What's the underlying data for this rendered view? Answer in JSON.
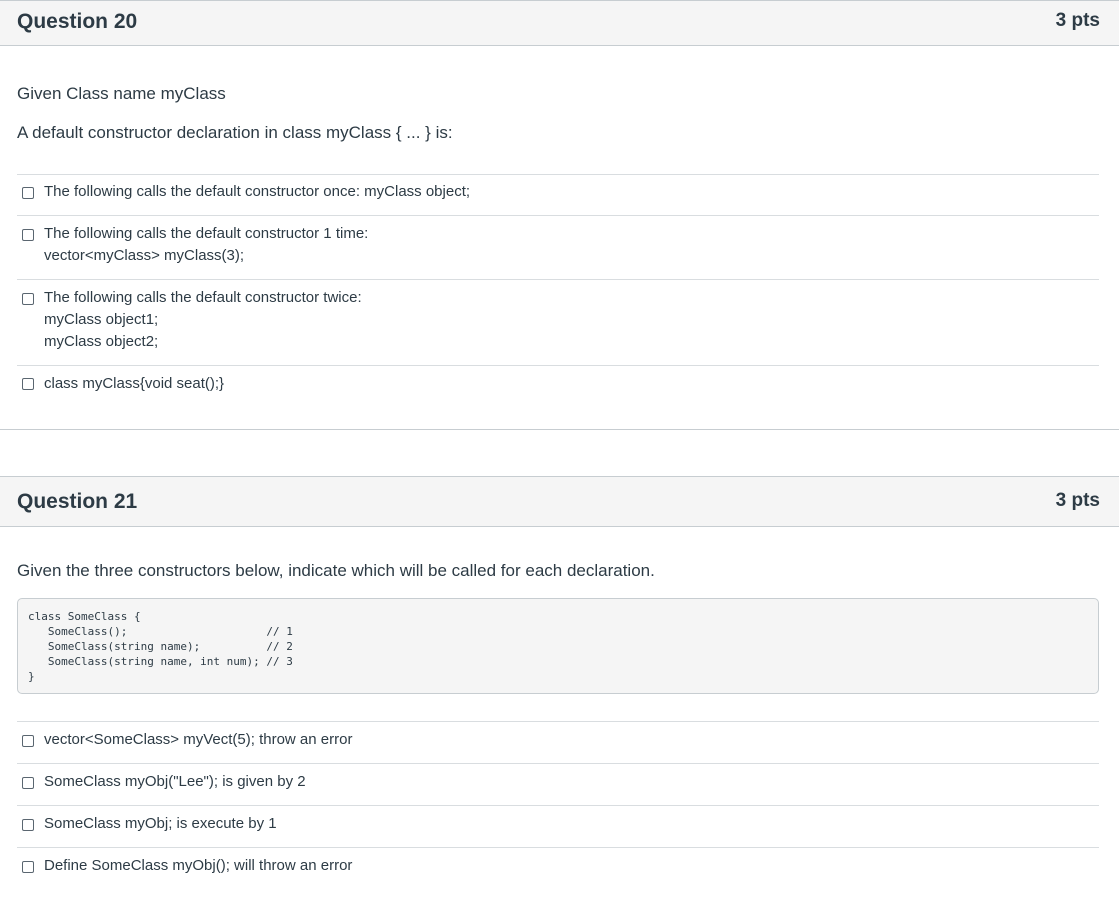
{
  "q20": {
    "title": "Question 20",
    "points": "3 pts",
    "text1": "Given Class name myClass",
    "text2": "A default constructor declaration in class myClass { ... } is:",
    "answers": [
      {
        "lines": [
          "The following calls the default constructor once: myClass object;"
        ],
        "checked": false
      },
      {
        "lines": [
          "The following calls the default constructor 1 time:",
          "vector<myClass> myClass(3);"
        ],
        "checked": false
      },
      {
        "lines": [
          "The following calls the default constructor twice:",
          "myClass object1;",
          "myClass object2;"
        ],
        "checked": false
      },
      {
        "lines": [
          "class myClass{void seat();}"
        ],
        "checked": false
      }
    ]
  },
  "q21": {
    "title": "Question 21",
    "points": "3 pts",
    "text1": "Given the three constructors below, indicate which will be called for each declaration.",
    "code": "class SomeClass {\n   SomeClass();                     // 1\n   SomeClass(string name);          // 2\n   SomeClass(string name, int num); // 3\n}",
    "answers": [
      {
        "lines": [
          "vector<SomeClass> myVect(5); throw an error"
        ],
        "checked": false
      },
      {
        "lines": [
          "SomeClass myObj(\"Lee\"); is given by 2"
        ],
        "checked": false
      },
      {
        "lines": [
          "SomeClass myObj; is execute by 1"
        ],
        "checked": false
      },
      {
        "lines": [
          "Define SomeClass myObj(); will throw an error"
        ],
        "checked": false
      }
    ]
  }
}
